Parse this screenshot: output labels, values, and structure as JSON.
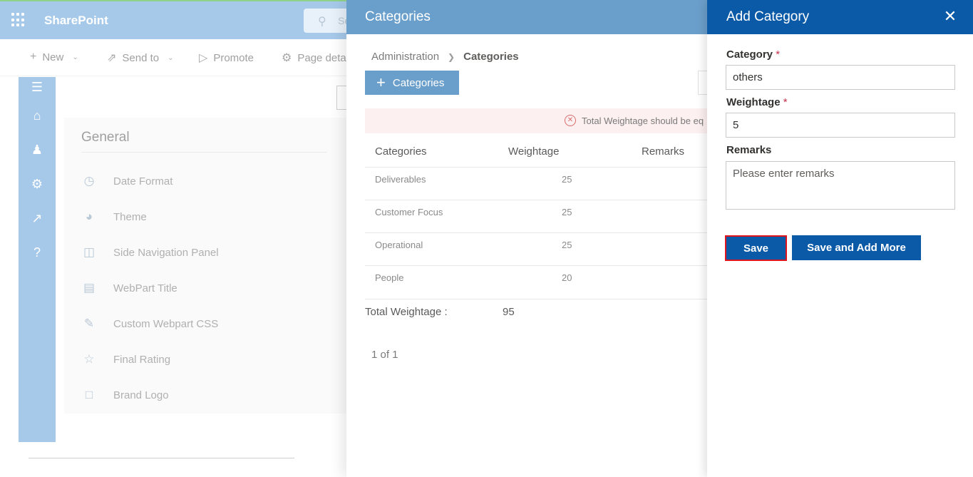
{
  "sharepoint": {
    "brand": "SharePoint",
    "search_placeholder": "Se",
    "commands": {
      "new": "New",
      "send_to": "Send to",
      "promote": "Promote",
      "page_details": "Page deta"
    },
    "settings": {
      "section_title": "General",
      "items": [
        {
          "label": "Date Format",
          "icon": "calendar-clock-icon"
        },
        {
          "label": "Theme",
          "icon": "palette-icon"
        },
        {
          "label": "Side Navigation Panel",
          "icon": "side-panel-icon"
        },
        {
          "label": "WebPart Title",
          "icon": "webpart-icon"
        },
        {
          "label": "Custom Webpart CSS",
          "icon": "edit-icon"
        },
        {
          "label": "Final Rating",
          "icon": "star-icon"
        },
        {
          "label": "Brand Logo",
          "icon": "briefcase-icon"
        }
      ]
    }
  },
  "categories_panel": {
    "title": "Categories",
    "breadcrumb": {
      "parent": "Administration",
      "current": "Categories"
    },
    "add_button": "Categories",
    "error_message": "Total Weightage should be eq",
    "columns": {
      "category": "Categories",
      "weightage": "Weightage",
      "remarks": "Remarks"
    },
    "rows": [
      {
        "category": "Deliverables",
        "weightage": "25"
      },
      {
        "category": "Customer Focus",
        "weightage": "25"
      },
      {
        "category": "Operational",
        "weightage": "25"
      },
      {
        "category": "People",
        "weightage": "20"
      }
    ],
    "total_label": "Total Weightage :",
    "total_value": "95",
    "pagination": "1 of 1"
  },
  "add_category": {
    "title": "Add Category",
    "category_label": "Category",
    "category_value": "others",
    "weightage_label": "Weightage",
    "weightage_value": "5",
    "remarks_label": "Remarks",
    "remarks_placeholder": "Please enter remarks",
    "required_mark": "*",
    "save": "Save",
    "save_and_add_more": "Save and Add More"
  },
  "colors": {
    "panel_header": "#0b5aa7",
    "dim_header": "#6b9fcb",
    "required": "#c4314b",
    "highlight_border": "#e0141e",
    "error_bg": "#fdf0f0"
  }
}
